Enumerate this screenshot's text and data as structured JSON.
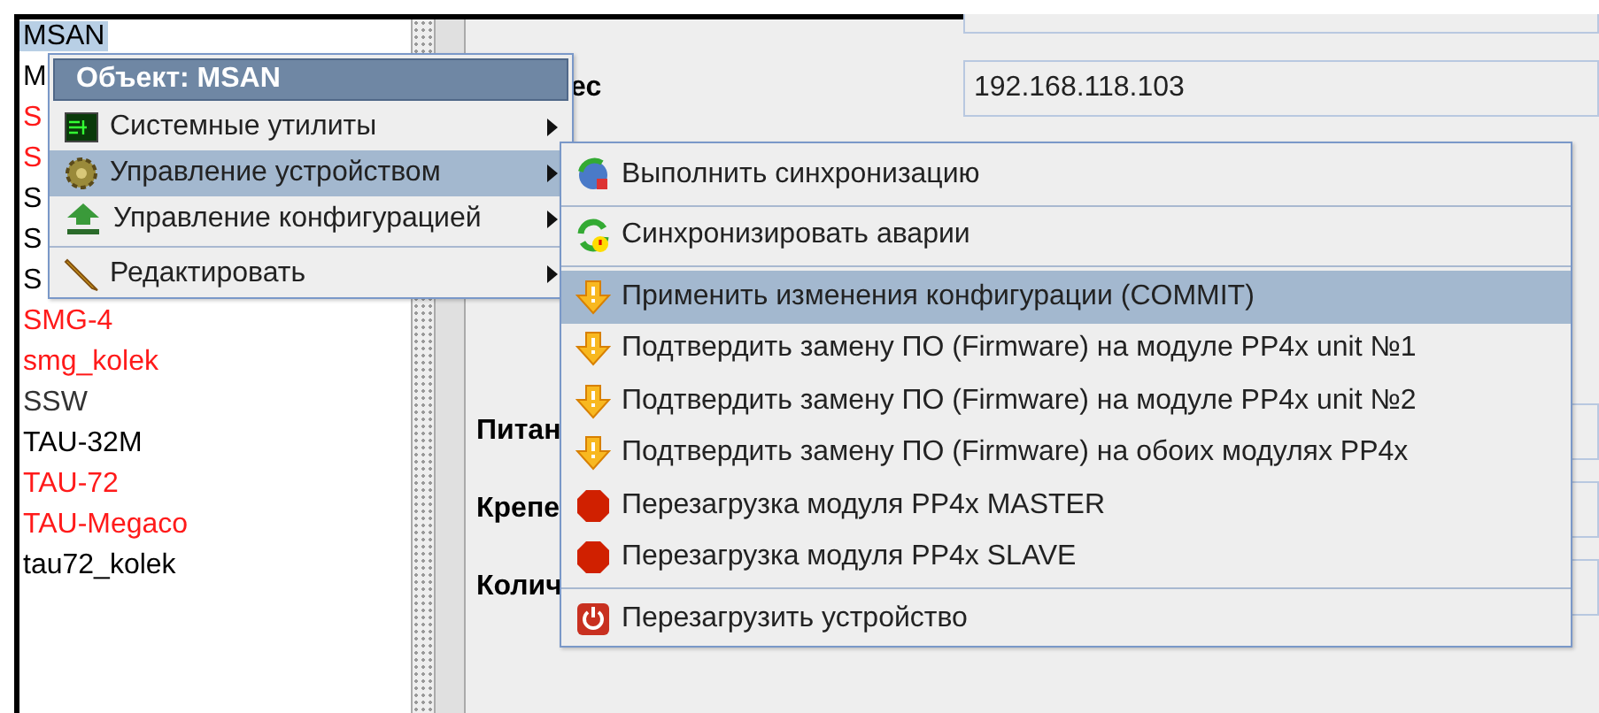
{
  "object_list": {
    "items": [
      {
        "label": "MSAN",
        "selected": true,
        "color": "#000000"
      },
      {
        "label": "M",
        "selected": false,
        "color": "#000000"
      },
      {
        "label": "S",
        "selected": false,
        "color": "#ff1a1a"
      },
      {
        "label": "S",
        "selected": false,
        "color": "#ff1a1a"
      },
      {
        "label": "S",
        "selected": false,
        "color": "#000000"
      },
      {
        "label": "S",
        "selected": false,
        "color": "#000000"
      },
      {
        "label": "S",
        "selected": false,
        "color": "#000000"
      },
      {
        "label": "SMG-4",
        "selected": false,
        "color": "#ff1a1a"
      },
      {
        "label": "smg_kolek",
        "selected": false,
        "color": "#ff1a1a"
      },
      {
        "label": "SSW",
        "selected": false,
        "color": "#333333"
      },
      {
        "label": "TAU-32M",
        "selected": false,
        "color": "#000000"
      },
      {
        "label": "TAU-72",
        "selected": false,
        "color": "#ff1a1a"
      },
      {
        "label": "TAU-Megaco",
        "selected": false,
        "color": "#ff1a1a"
      },
      {
        "label": "tau72_kolek",
        "selected": false,
        "color": "#000000"
      }
    ]
  },
  "form": {
    "rows": [
      {
        "label": "ес",
        "value": "192.168.118.103"
      },
      {
        "label": "Питан"
      },
      {
        "label": "Крепе"
      },
      {
        "label": "Колич"
      }
    ]
  },
  "context_menu": {
    "title": "Объект: MSAN",
    "items": [
      {
        "label": "Системные утилиты",
        "kind": "utilities",
        "selected": false,
        "separator_before": false
      },
      {
        "label": "Управление устройством",
        "kind": "device",
        "selected": true,
        "separator_before": false
      },
      {
        "label": "Управление конфигурацией",
        "kind": "config",
        "selected": false,
        "separator_before": false
      },
      {
        "label": "Редактировать",
        "kind": "edit",
        "selected": false,
        "separator_before": true
      }
    ]
  },
  "submenu": {
    "items": [
      {
        "label": "Выполнить синхронизацию",
        "kind": "sync",
        "selected": false,
        "separator_before": false
      },
      {
        "label": "Синхронизировать аварии",
        "kind": "alarms",
        "selected": false,
        "separator_before": true
      },
      {
        "label": "Применить изменения конфигурации (COMMIT)",
        "kind": "confirm",
        "selected": true,
        "separator_before": true
      },
      {
        "label": "Подтвердить замену ПО (Firmware) на модуле PP4x unit №1",
        "kind": "confirm",
        "selected": false,
        "separator_before": false
      },
      {
        "label": "Подтвердить замену ПО (Firmware) на модуле PP4x unit №2",
        "kind": "confirm",
        "selected": false,
        "separator_before": false
      },
      {
        "label": "Подтвердить замену ПО (Firmware) на обоих модулях PP4x",
        "kind": "confirm",
        "selected": false,
        "separator_before": false
      },
      {
        "label": "Перезагрузка модуля PP4x MASTER",
        "kind": "stop",
        "selected": false,
        "separator_before": false
      },
      {
        "label": "Перезагрузка модуля PP4x SLAVE",
        "kind": "stop",
        "selected": false,
        "separator_before": false
      },
      {
        "label": "Перезагрузить устройство",
        "kind": "power",
        "selected": false,
        "separator_before": true
      }
    ]
  }
}
